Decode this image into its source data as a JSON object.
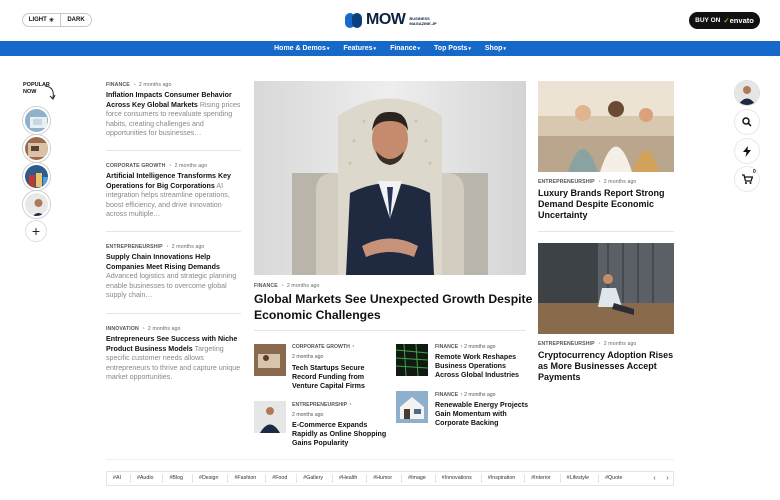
{
  "header": {
    "mode_light": "LIGHT",
    "mode_dark": "DARK",
    "logo_word": "MOW",
    "logo_sub_1": "BUSINESS",
    "logo_sub_2": "MAGAZINE.JP",
    "buy_prefix": "BUY ON",
    "buy_brand": "envato"
  },
  "nav": [
    {
      "label": "Home & Demos"
    },
    {
      "label": "Features"
    },
    {
      "label": "Finance"
    },
    {
      "label": "Top Posts"
    },
    {
      "label": "Shop"
    }
  ],
  "popular": {
    "label_1": "POPULAR",
    "label_2": "NOW"
  },
  "left_articles": [
    {
      "category": "FINANCE",
      "time": "2 months ago",
      "title": "Inflation Impacts Consumer Behavior Across Key Global Markets",
      "excerpt": "Rising prices force consumers to reevaluate spending habits, creating challenges and opportunities for businesses…"
    },
    {
      "category": "CORPORATE GROWTH",
      "time": "2 months ago",
      "title": "Artificial Intelligence Transforms Key Operations for Big Corporations",
      "excerpt": "AI integration helps streamline operations, boost efficiency, and drive innovation across multiple…"
    },
    {
      "category": "ENTREPRENEURSHIP",
      "time": "2 months ago",
      "title": "Supply Chain Innovations Help Companies Meet Rising Demands",
      "excerpt": "Advanced logistics and strategic planning enable businesses to overcome global supply chain…"
    },
    {
      "category": "INNOVATION",
      "time": "2 months ago",
      "title": "Entrepreneurs See Success with Niche Product Business Models",
      "excerpt": "Targeting specific customer needs allows entrepreneurs to thrive and capture unique market opportunities."
    }
  ],
  "hero": {
    "category": "FINANCE",
    "time": "2 months ago",
    "title": "Global Markets See Unexpected Growth Despite Economic Challenges"
  },
  "small_articles": [
    {
      "category": "CORPORATE GROWTH",
      "time": "2 months ago",
      "title": "Tech Startups Secure Record Funding from Venture Capital Firms"
    },
    {
      "category": "FINANCE",
      "time": "2 months ago",
      "title": "Remote Work Reshapes Business Operations Across Global Industries"
    },
    {
      "category": "ENTREPRENEURSHIP",
      "time": "2 months ago",
      "title": "E-Commerce Expands Rapidly as Online Shopping Gains Popularity"
    },
    {
      "category": "FINANCE",
      "time": "2 months ago",
      "title": "Renewable Energy Projects Gain Momentum with Corporate Backing"
    }
  ],
  "right_articles": [
    {
      "category": "ENTREPRENEURSHIP",
      "time": "2 months ago",
      "title": "Luxury Brands Report Strong Demand Despite Economic Uncertainty"
    },
    {
      "category": "ENTREPRENEURSHIP",
      "time": "2 months ago",
      "title": "Cryptocurrency Adoption Rises as More Businesses Accept Payments"
    }
  ],
  "cart_count": "0",
  "tags": [
    "#AI",
    "#Audio",
    "#Blog",
    "#Design",
    "#Fashion",
    "#Food",
    "#Gallery",
    "#Health",
    "#Humor",
    "#Image",
    "#Innovations",
    "#Inspiration",
    "#Interior",
    "#Lifestyle",
    "#Quote"
  ],
  "tag_prev": "‹",
  "tag_next": "›",
  "colors": {
    "accent": "#1769c9",
    "dark": "#111111"
  }
}
